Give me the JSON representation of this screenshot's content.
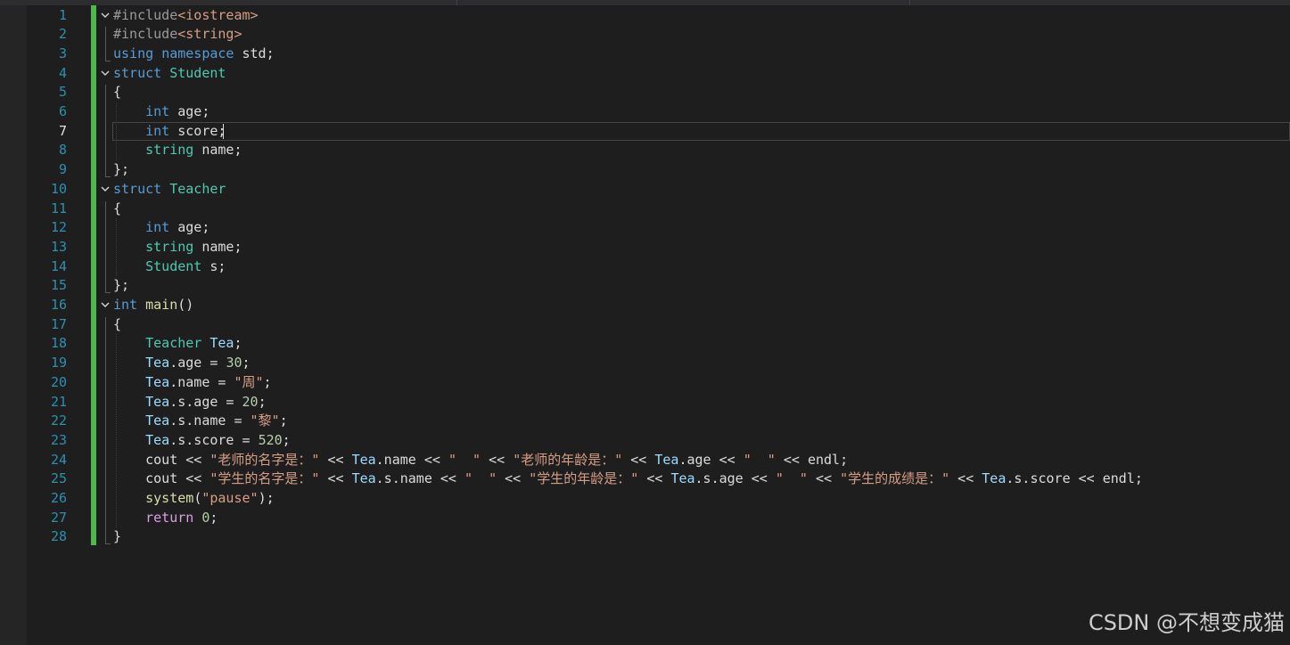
{
  "editor": {
    "active_line": 7,
    "lines": [
      [
        {
          "t": "#include",
          "c": "pp"
        },
        {
          "t": "<iostream>",
          "c": "inc"
        }
      ],
      [
        {
          "t": "#include",
          "c": "pp"
        },
        {
          "t": "<string>",
          "c": "inc"
        }
      ],
      [
        {
          "t": "using",
          "c": "kw"
        },
        {
          "t": " "
        },
        {
          "t": "namespace",
          "c": "kw"
        },
        {
          "t": " std;"
        }
      ],
      [
        {
          "t": "struct",
          "c": "kw"
        },
        {
          "t": " "
        },
        {
          "t": "Student",
          "c": "typ"
        }
      ],
      [
        {
          "t": "{"
        }
      ],
      [
        {
          "t": "    "
        },
        {
          "t": "int",
          "c": "kw"
        },
        {
          "t": " age;"
        }
      ],
      [
        {
          "t": "    "
        },
        {
          "t": "int",
          "c": "kw"
        },
        {
          "t": " score;"
        }
      ],
      [
        {
          "t": "    "
        },
        {
          "t": "string",
          "c": "typ"
        },
        {
          "t": " name;"
        }
      ],
      [
        {
          "t": "};"
        }
      ],
      [
        {
          "t": "struct",
          "c": "kw"
        },
        {
          "t": " "
        },
        {
          "t": "Teacher",
          "c": "typ"
        }
      ],
      [
        {
          "t": "{"
        }
      ],
      [
        {
          "t": "    "
        },
        {
          "t": "int",
          "c": "kw"
        },
        {
          "t": " age;"
        }
      ],
      [
        {
          "t": "    "
        },
        {
          "t": "string",
          "c": "typ"
        },
        {
          "t": " name;"
        }
      ],
      [
        {
          "t": "    "
        },
        {
          "t": "Student",
          "c": "typ"
        },
        {
          "t": " s;"
        }
      ],
      [
        {
          "t": "};"
        }
      ],
      [
        {
          "t": "int",
          "c": "kw"
        },
        {
          "t": " "
        },
        {
          "t": "main",
          "c": "fn"
        },
        {
          "t": "()"
        }
      ],
      [
        {
          "t": "{"
        }
      ],
      [
        {
          "t": "    "
        },
        {
          "t": "Teacher",
          "c": "typ"
        },
        {
          "t": " "
        },
        {
          "t": "Tea",
          "c": "var"
        },
        {
          "t": ";"
        }
      ],
      [
        {
          "t": "    "
        },
        {
          "t": "Tea",
          "c": "var"
        },
        {
          "t": ".age = "
        },
        {
          "t": "30",
          "c": "num"
        },
        {
          "t": ";"
        }
      ],
      [
        {
          "t": "    "
        },
        {
          "t": "Tea",
          "c": "var"
        },
        {
          "t": ".name = "
        },
        {
          "t": "\"周\"",
          "c": "str"
        },
        {
          "t": ";"
        }
      ],
      [
        {
          "t": "    "
        },
        {
          "t": "Tea",
          "c": "var"
        },
        {
          "t": ".s.age = "
        },
        {
          "t": "20",
          "c": "num"
        },
        {
          "t": ";"
        }
      ],
      [
        {
          "t": "    "
        },
        {
          "t": "Tea",
          "c": "var"
        },
        {
          "t": ".s.name = "
        },
        {
          "t": "\"黎\"",
          "c": "str"
        },
        {
          "t": ";"
        }
      ],
      [
        {
          "t": "    "
        },
        {
          "t": "Tea",
          "c": "var"
        },
        {
          "t": ".s.score = "
        },
        {
          "t": "520",
          "c": "num"
        },
        {
          "t": ";"
        }
      ],
      [
        {
          "t": "    cout << "
        },
        {
          "t": "\"老师的名字是：\"",
          "c": "str"
        },
        {
          "t": " << "
        },
        {
          "t": "Tea",
          "c": "var"
        },
        {
          "t": ".name << "
        },
        {
          "t": "\"  \"",
          "c": "str"
        },
        {
          "t": " << "
        },
        {
          "t": "\"老师的年龄是：\"",
          "c": "str"
        },
        {
          "t": " << "
        },
        {
          "t": "Tea",
          "c": "var"
        },
        {
          "t": ".age << "
        },
        {
          "t": "\"  \"",
          "c": "str"
        },
        {
          "t": " << endl;"
        }
      ],
      [
        {
          "t": "    cout << "
        },
        {
          "t": "\"学生的名字是：\"",
          "c": "str"
        },
        {
          "t": " << "
        },
        {
          "t": "Tea",
          "c": "var"
        },
        {
          "t": ".s.name << "
        },
        {
          "t": "\"  \"",
          "c": "str"
        },
        {
          "t": " << "
        },
        {
          "t": "\"学生的年龄是：\"",
          "c": "str"
        },
        {
          "t": " << "
        },
        {
          "t": "Tea",
          "c": "var"
        },
        {
          "t": ".s.age << "
        },
        {
          "t": "\"  \"",
          "c": "str"
        },
        {
          "t": " << "
        },
        {
          "t": "\"学生的成绩是：\"",
          "c": "str"
        },
        {
          "t": " << "
        },
        {
          "t": "Tea",
          "c": "var"
        },
        {
          "t": ".s.score << endl;"
        }
      ],
      [
        {
          "t": "    "
        },
        {
          "t": "system",
          "c": "fn"
        },
        {
          "t": "("
        },
        {
          "t": "\"pause\"",
          "c": "str"
        },
        {
          "t": ");"
        }
      ],
      [
        {
          "t": "    "
        },
        {
          "t": "return",
          "c": "ctl"
        },
        {
          "t": " "
        },
        {
          "t": "0",
          "c": "num"
        },
        {
          "t": ";"
        }
      ],
      [
        {
          "t": "}"
        }
      ]
    ],
    "fold_lines": [
      1,
      4,
      10,
      16
    ]
  },
  "watermark": "CSDN @不想变成猫"
}
